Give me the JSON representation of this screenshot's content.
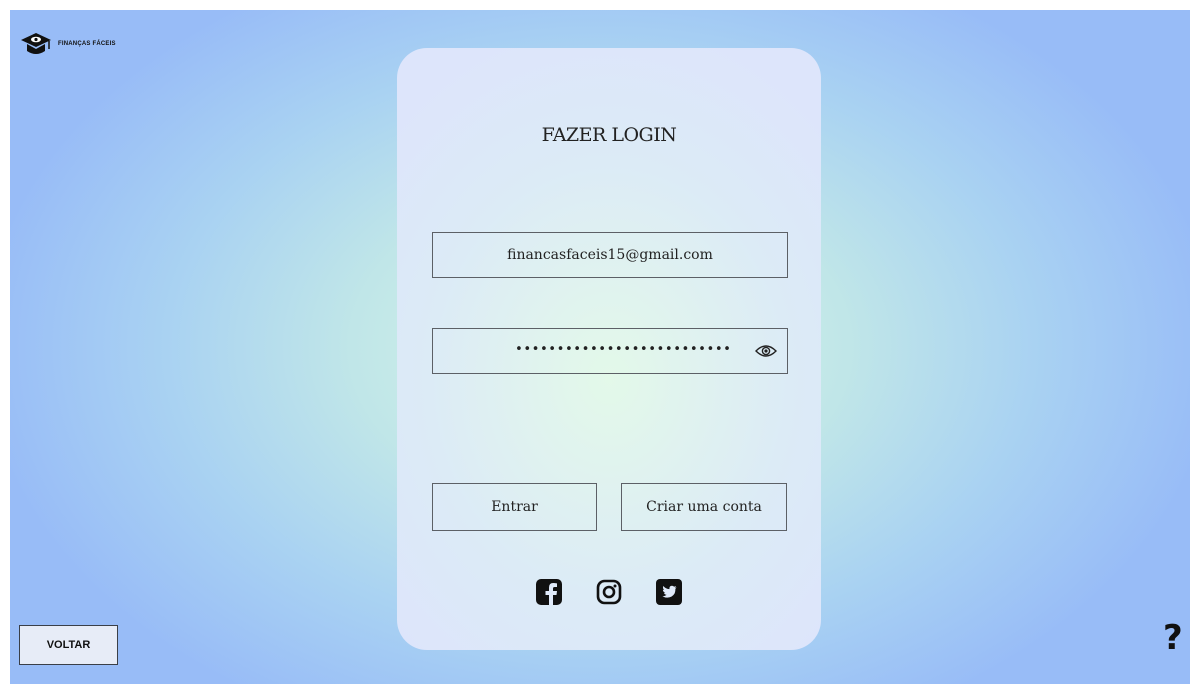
{
  "brand": {
    "name": "FINANÇAS FÁCEIS",
    "logo_icon": "graduation-cap-eye-icon"
  },
  "login": {
    "title": "FAZER LOGIN",
    "email_value": "financasfaceis15@gmail.com",
    "password_masked": "••••••••••••••••••••••••••",
    "password_toggle_icon": "eye-icon",
    "enter_label": "Entrar",
    "create_account_label": "Criar uma conta"
  },
  "social": [
    {
      "name": "facebook",
      "icon": "facebook-icon"
    },
    {
      "name": "instagram",
      "icon": "instagram-icon"
    },
    {
      "name": "twitter",
      "icon": "twitter-icon"
    }
  ],
  "footer": {
    "back_label": "VOLTAR",
    "help_label": "?"
  },
  "colors": {
    "background_center": "#d9f7e6",
    "background_edge": "#98bcf7",
    "card": "#dde5fb",
    "text": "#222222"
  }
}
